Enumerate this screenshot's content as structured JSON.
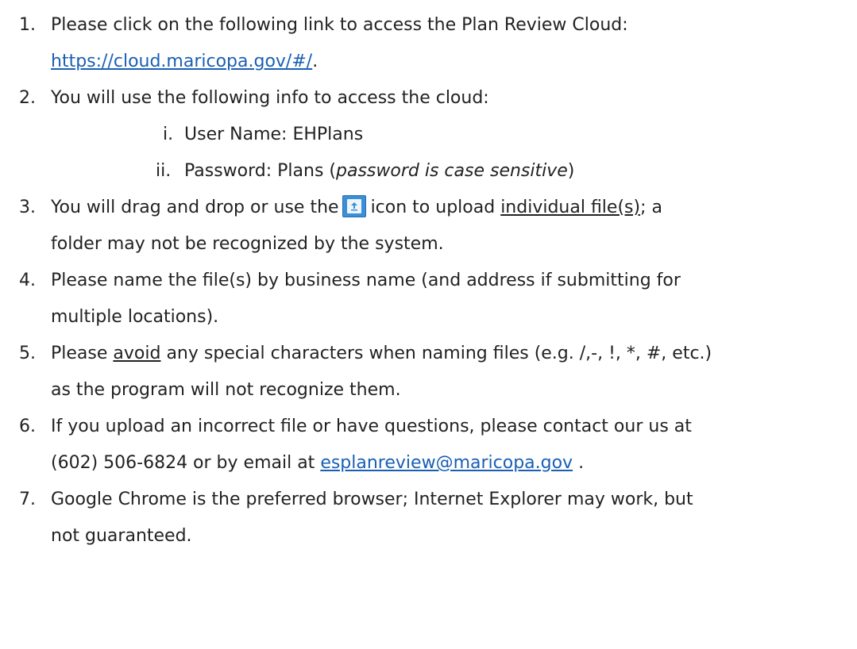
{
  "items": {
    "i1": {
      "num": "1.",
      "text": "Please click on the following link to access the Plan Review Cloud:",
      "link": "https://cloud.maricopa.gov/#/",
      "after": "."
    },
    "i2": {
      "num": "2.",
      "text": "You will use the following info to access the cloud:",
      "sub1_num": "i.",
      "sub1_text": "User Name: EHPlans",
      "sub2_num": "ii.",
      "sub2_pre": "Password: Plans (",
      "sub2_em": "password is case sensitive",
      "sub2_post": ")"
    },
    "i3": {
      "num": "3.",
      "pre": "You will drag and drop or use the",
      "mid": "icon to upload",
      "u": "individual file(s)",
      "post": "; a",
      "line2": "folder may not be recognized by the system.",
      "icon": "upload-icon"
    },
    "i4": {
      "num": "4.",
      "line1": "Please name the file(s) by business name (and address if submitting for",
      "line2": "multiple locations)."
    },
    "i5": {
      "num": "5.",
      "pre": "Please",
      "u": "avoid",
      "post": "any special characters when naming files (e.g. /,-, !, *, #, etc.)",
      "line2": "as the program will not recognize them."
    },
    "i6": {
      "num": "6.",
      "line1": "If you upload an incorrect file or have questions, please contact our us at",
      "pre2": "(602) 506-6824 or by email at",
      "email": "esplanreview@maricopa.gov",
      "post2": "."
    },
    "i7": {
      "num": "7.",
      "line1": "Google Chrome is the preferred browser; Internet Explorer may work, but",
      "line2": "not guaranteed."
    }
  },
  "colors": {
    "text": "#222222",
    "link": "#1a5fb4",
    "icon_blue": "#3a8fd6"
  }
}
